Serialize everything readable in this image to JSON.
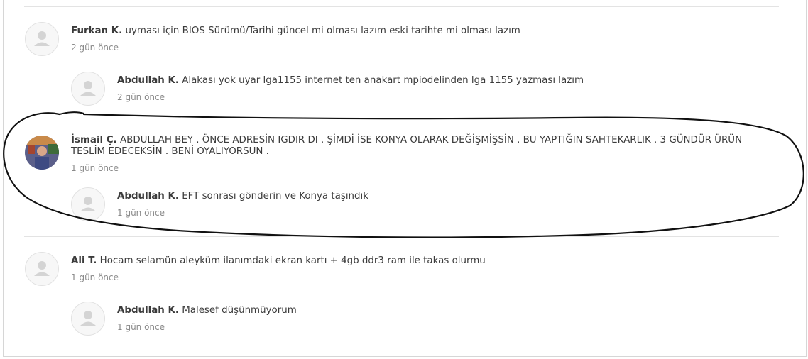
{
  "comments": [
    {
      "author": "Furkan K.",
      "text": "uyması için BIOS Sürümü/Tarihi güncel mi olması lazım eski tarihte mi olması lazım",
      "time": "2 gün önce",
      "reply": {
        "author": "Abdullah K.",
        "text": "Alakası yok uyar lga1155 internet ten anakart mpiodelinden lga 1155 yazması lazım",
        "time": "2 gün önce"
      }
    },
    {
      "author": "İsmail Ç.",
      "text": "ABDULLAH BEY . ÖNCE ADRESİN IGDIR DI . ŞİMDİ İSE KONYA OLARAK DEĞİŞMİŞSİN . BU YAPTIĞIN SAHTEKARLIK . 3 GÜNDÜR ÜRÜN TESLİM EDECEKSİN . BENİ OYALIYORSUN .",
      "time": "1 gün önce",
      "reply": {
        "author": "Abdullah K.",
        "text": "EFT sonrası gönderin ve Konya taşındık",
        "time": "1 gün önce"
      }
    },
    {
      "author": "Ali T.",
      "text": "Hocam selamün aleyküm ilanımdaki ekran kartı + 4gb ddr3 ram ile takas olurmu",
      "time": "1 gün önce",
      "reply": {
        "author": "Abdullah K.",
        "text": "Malesef düşünmüyorum",
        "time": "1 gün önce"
      }
    }
  ],
  "icons": {
    "default_avatar": "user-silhouette-icon",
    "photo_avatar": "user-photo"
  },
  "colors": {
    "annotation_ink": "#111111",
    "divider": "#e3e3e3",
    "time_text": "#8a8a8a"
  }
}
